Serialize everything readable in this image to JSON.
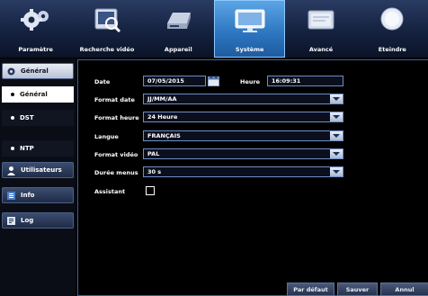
{
  "toolbar": {
    "items": [
      {
        "label": "Paramètre",
        "icon": "gears-icon"
      },
      {
        "label": "Recherche vidéo",
        "icon": "video-search-icon"
      },
      {
        "label": "Appareil",
        "icon": "hard-drive-icon"
      },
      {
        "label": "Système",
        "icon": "monitor-icon"
      },
      {
        "label": "Avancé",
        "icon": "advanced-icon"
      },
      {
        "label": "Eteindre",
        "icon": "power-icon"
      }
    ],
    "active_index": 3
  },
  "sidebar": {
    "general_cat": "Général",
    "general_sub": "Général",
    "dst": "DST",
    "ntp": "NTP",
    "users": "Utilisateurs",
    "info": "Info",
    "log": "Log"
  },
  "form": {
    "date_label": "Date",
    "date_value": "07/05/2015",
    "heure_label": "Heure",
    "heure_value": "16:09:31",
    "format_date_label": "Format date",
    "format_date_value": "JJ/MM/AA",
    "format_heure_label": "Format heure",
    "format_heure_value": "24 Heure",
    "langue_label": "Langue",
    "langue_value": "FRANÇAIS",
    "format_video_label": "Format vidéo",
    "format_video_value": "PAL",
    "duree_menus_label": "Durée menus",
    "duree_menus_value": "30 s",
    "assistant_label": "Assistant",
    "assistant_checked": false
  },
  "buttons": {
    "default": "Par défaut",
    "save": "Sauver",
    "cancel": "Annul"
  },
  "colors": {
    "toolbar_bg": "#152240",
    "active_tab": "#2b74bf",
    "field_border": "#6f8ec4",
    "panel_border": "#3d5f9b"
  }
}
